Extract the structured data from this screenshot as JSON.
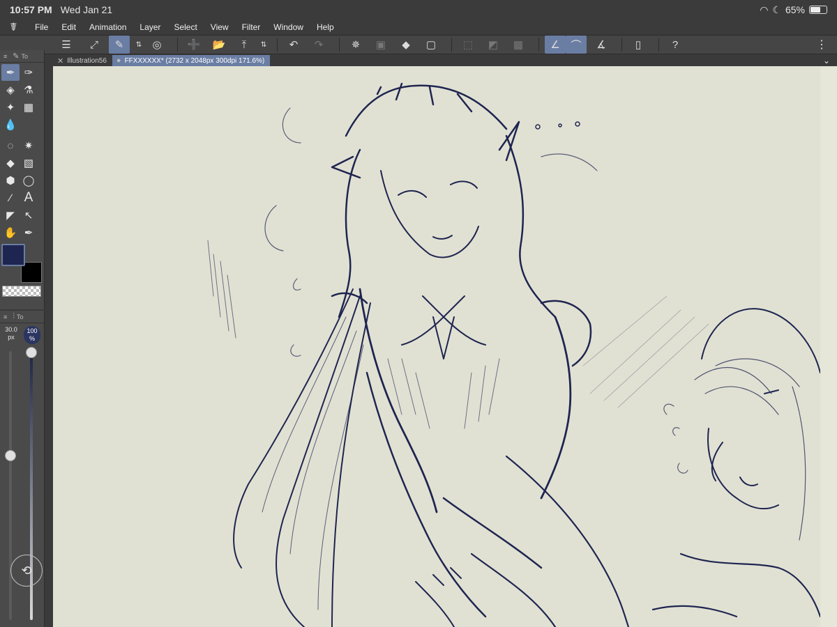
{
  "status_bar": {
    "time": "10:57 PM",
    "date": "Wed Jan 21",
    "battery": "65%",
    "battery_level": 0.65
  },
  "menu": [
    "File",
    "Edit",
    "Animation",
    "Layer",
    "Select",
    "View",
    "Filter",
    "Window",
    "Help"
  ],
  "tool_panel": {
    "title": "To",
    "foreground_color": "#1e2550",
    "background_color": "#000000"
  },
  "brush_panel": {
    "title": "To",
    "size": "30.0",
    "size_unit": "px",
    "opacity": "100",
    "opacity_unit": "%",
    "opacity_level": 1.0
  },
  "tabs": [
    {
      "label": "Illustration56",
      "active": false
    },
    {
      "label": "FFXXXXXX* (2732 x 2048px 300dpi 171.6%)",
      "active": true
    }
  ],
  "canvas": {
    "paper_color": "#e1e1d3",
    "ink_color": "#1e2550"
  }
}
